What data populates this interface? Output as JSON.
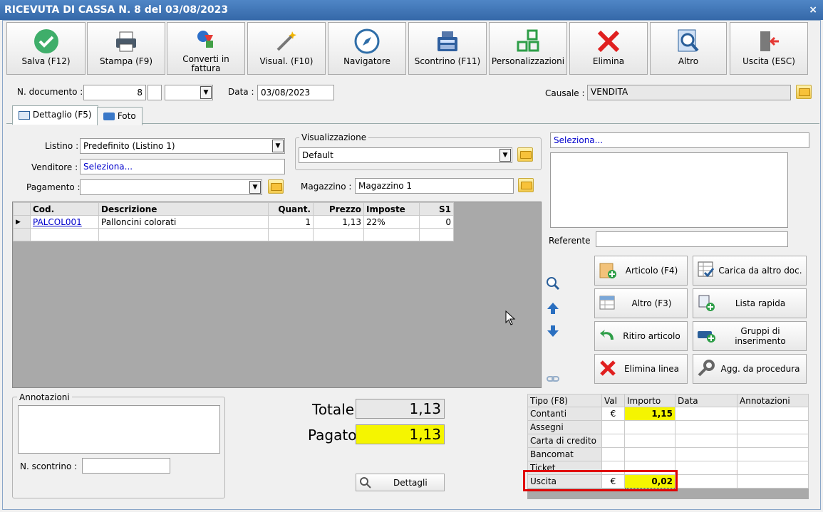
{
  "window": {
    "title": "RICEVUTA DI CASSA N. 8 del 03/08/2023",
    "close": "×"
  },
  "toolbar": [
    {
      "label": "Salva (F12)",
      "icon": "check-icon"
    },
    {
      "label": "Stampa (F9)",
      "icon": "printer-icon"
    },
    {
      "label": "Converti in fattura",
      "icon": "convert-icon"
    },
    {
      "label": "Visual. (F10)",
      "icon": "wand-icon"
    },
    {
      "label": "Navigatore",
      "icon": "compass-icon"
    },
    {
      "label": "Scontrino (F11)",
      "icon": "cash-register-icon"
    },
    {
      "label": "Personalizzazioni",
      "icon": "grid-icon"
    },
    {
      "label": "Elimina",
      "icon": "x-icon"
    },
    {
      "label": "Altro",
      "icon": "magnifier-icon"
    },
    {
      "label": "Uscita (ESC)",
      "icon": "exit-icon"
    }
  ],
  "header": {
    "ndoc_label": "N. documento :",
    "ndoc_value": "8",
    "data_label": "Data :",
    "data_value": "03/08/2023",
    "causale_label": "Causale :",
    "causale_value": "VENDITA"
  },
  "tabs": [
    {
      "label": "Dettaglio (F5)"
    },
    {
      "label": "Foto"
    }
  ],
  "form": {
    "listino_label": "Listino :",
    "listino_value": "Predefinito (Listino 1)",
    "venditore_label": "Venditore :",
    "venditore_value": "Seleziona...",
    "pagamento_label": "Pagamento :",
    "pagamento_value": "",
    "visualizzazione_label": "Visualizzazione",
    "visualizzazione_value": "Default",
    "magazzino_label": "Magazzino :",
    "magazzino_value": "Magazzino 1",
    "seleziona_value": "Seleziona...",
    "referente_label": "Referente",
    "referente_value": ""
  },
  "items_table": {
    "headers": [
      "Cod.",
      "Descrizione",
      "Quant.",
      "Prezzo",
      "Imposte",
      "S1"
    ],
    "rows": [
      {
        "cod": "PALCOL001",
        "descrizione": "Palloncini colorati",
        "quant": "1",
        "prezzo": "1,13",
        "imposte": "22%",
        "s1": "0"
      }
    ]
  },
  "actions": [
    {
      "label": "Articolo (F4)"
    },
    {
      "label": "Carica da altro doc."
    },
    {
      "label": "Altro (F3)"
    },
    {
      "label": "Lista rapida"
    },
    {
      "label": "Ritiro articolo"
    },
    {
      "label": "Gruppi di inserimento"
    },
    {
      "label": "Elimina linea"
    },
    {
      "label": "Agg. da procedura"
    }
  ],
  "annotazioni": {
    "label": "Annotazioni",
    "scontrino_label": "N. scontrino :",
    "scontrino_value": ""
  },
  "totals": {
    "totale_label": "Totale",
    "totale_value": "1,13",
    "pagato_label": "Pagato",
    "pagato_value": "1,13",
    "dettagli_label": "Dettagli"
  },
  "payments": {
    "headers": [
      "Tipo (F8)",
      "Val",
      "Importo",
      "Data",
      "Annotazioni"
    ],
    "rows": [
      {
        "tipo": "Contanti",
        "val": "€",
        "importo": "1,15"
      },
      {
        "tipo": "Assegni",
        "val": "",
        "importo": ""
      },
      {
        "tipo": "Carta di credito",
        "val": "",
        "importo": ""
      },
      {
        "tipo": "Bancomat",
        "val": "",
        "importo": ""
      },
      {
        "tipo": "Ticket",
        "val": "",
        "importo": ""
      },
      {
        "tipo": "Uscita",
        "val": "€",
        "importo": "0,02"
      }
    ]
  },
  "colors": {
    "title_bar": "#3f76b8",
    "highlight_yellow": "#f5f500",
    "red_box": "#e00000",
    "link_blue": "#0000cc"
  }
}
